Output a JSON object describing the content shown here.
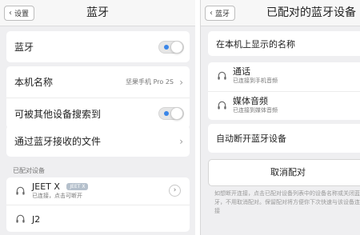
{
  "left": {
    "back_label": "设置",
    "title": "蓝牙",
    "bluetooth": {
      "label": "蓝牙",
      "on": true
    },
    "device_name": {
      "label": "本机名称",
      "value": "坚果手机 Pro 2S"
    },
    "discoverable": {
      "label": "可被其他设备搜索到",
      "on": true
    },
    "received_files": {
      "label": "通过蓝牙接收的文件"
    },
    "paired_header": "已配对设备",
    "paired_devices": [
      {
        "name": "JEET X",
        "tag": "JEET X",
        "status": "已连接，点击可断开"
      },
      {
        "name": "J2",
        "status": ""
      }
    ]
  },
  "right": {
    "back_label": "蓝牙",
    "title": "已配对的蓝牙设备",
    "display_name_label": "在本机上显示的名称",
    "profiles": [
      {
        "name": "通话",
        "status": "已连接到手机音频"
      },
      {
        "name": "媒体音频",
        "status": "已连接到媒体音频"
      }
    ],
    "auto_disconnect_label": "自动断开蓝牙设备",
    "unpair_label": "取消配对",
    "footnote": "如想断开连接，点击已配对设备列表中的设备名称或关闭蓝牙，不用取消配对。保留配对将方便你下次快速与该设备连接"
  },
  "colors": {
    "accent": "#3a86e8",
    "background": "#efeff1"
  },
  "icons": {
    "back": "chevron-left-icon",
    "chevron": "chevron-right-icon",
    "headphone": "headphone-icon"
  }
}
